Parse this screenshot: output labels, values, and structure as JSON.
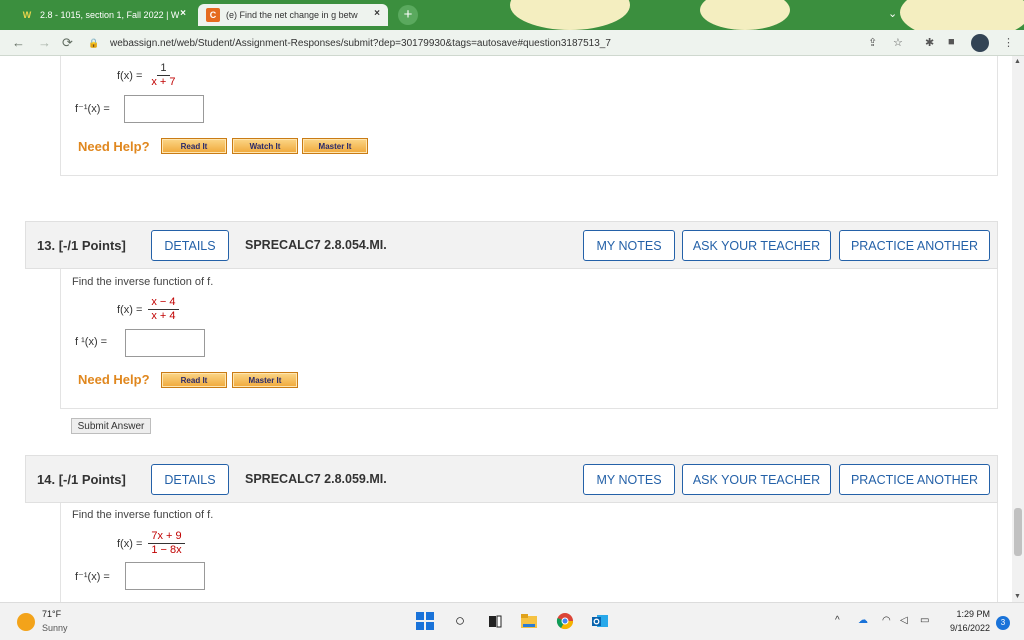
{
  "browser": {
    "tabs": [
      {
        "label": "2.8 - 1015, section 1, Fall 2022 | W",
        "icon": "webassign-icon"
      },
      {
        "label": "(e) Find the net change in g betw",
        "icon": "chegg-icon"
      }
    ],
    "url": "webassign.net/web/Student/Assignment-Responses/submit?dep=30179930&tags=autosave#question3187513_7",
    "tab_icon_text": {
      "webassign": "W",
      "chegg": "C"
    },
    "close_glyph": "×",
    "new_tab_glyph": "+"
  },
  "prev_question": {
    "fx_label": "f(x) =",
    "fx_numerator": "1",
    "fx_denominator": "x + 7",
    "answer_label": "f⁻¹(x) =",
    "need_help": "Need Help?",
    "buttons": [
      "Read It",
      "Watch It",
      "Master It"
    ]
  },
  "questions": [
    {
      "number": "13.",
      "points": "[-/1 Points]",
      "details": "DETAILS",
      "code": "SPRECALC7 2.8.054.MI.",
      "my_notes": "MY NOTES",
      "ask_teacher": "ASK YOUR TEACHER",
      "practice": "PRACTICE ANOTHER",
      "prompt": "Find the inverse function of f.",
      "fx_label": "f(x) =",
      "fx_numerator": "x − 4",
      "fx_denominator": "x + 4",
      "answer_label": "f ¹(x) =",
      "need_help": "Need Help?",
      "buttons": [
        "Read It",
        "Master It"
      ],
      "submit": "Submit Answer"
    },
    {
      "number": "14.",
      "points": "[-/1 Points]",
      "details": "DETAILS",
      "code": "SPRECALC7 2.8.059.MI.",
      "my_notes": "MY NOTES",
      "ask_teacher": "ASK YOUR TEACHER",
      "practice": "PRACTICE ANOTHER",
      "prompt": "Find the inverse function of f.",
      "fx_label": "f(x) =",
      "fx_numerator": "7x + 9",
      "fx_denominator": "1 − 8x",
      "answer_label": "f⁻¹(x) ="
    }
  ],
  "taskbar": {
    "temperature": "71°F",
    "condition": "Sunny",
    "time": "1:29 PM",
    "date": "9/16/2022",
    "notifications": "3"
  },
  "colors": {
    "tabbar": "#3b8f3e",
    "accent_blue": "#2461a8",
    "help_orange": "#e0871e",
    "math_red": "#c00000"
  }
}
